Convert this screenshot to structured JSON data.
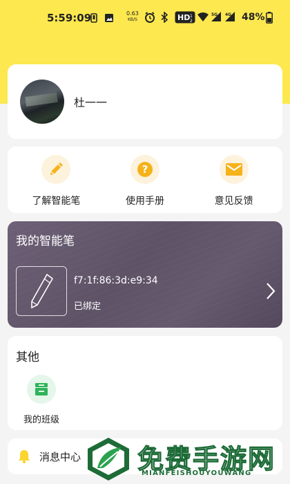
{
  "status_bar": {
    "time": "5:59:09",
    "speed_value": "0.63",
    "speed_unit": "KB/S",
    "battery": "48%",
    "icons": [
      "phone-icon",
      "image-icon",
      "alarm-icon",
      "bluetooth-icon",
      "hd-icon",
      "wifi-icon",
      "signal-5g-icon",
      "signal-4g-icon",
      "battery-icon"
    ]
  },
  "profile": {
    "username": "杜一一"
  },
  "quick_actions": [
    {
      "label": "了解智能笔",
      "icon": "pencil-icon"
    },
    {
      "label": "使用手册",
      "icon": "question-icon"
    },
    {
      "label": "意见反馈",
      "icon": "mail-icon"
    }
  ],
  "pen": {
    "title": "我的智能笔",
    "mac": "f7:1f:86:3d:e9:34",
    "status": "已绑定"
  },
  "other": {
    "title": "其他",
    "class_label": "我的班级"
  },
  "messages": {
    "label": "消息中心"
  },
  "watermark": {
    "title": "免费手游网",
    "subtitle": "MIANFEISHOUYOUWANG"
  },
  "colors": {
    "accent_yellow": "#fde84f",
    "icon_orange": "#f6b21b",
    "class_green": "#2eb35a",
    "pen_card": "#65596e"
  }
}
